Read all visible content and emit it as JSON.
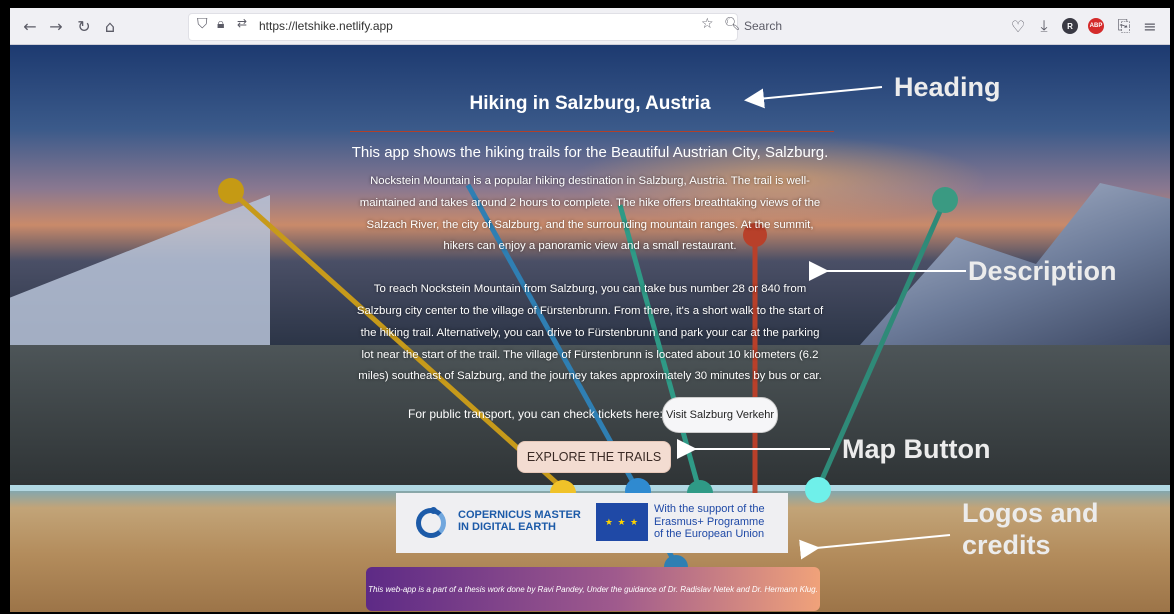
{
  "browser": {
    "url": "https://letshike.netlify.app",
    "search_placeholder": "Search",
    "icons": [
      "back-icon",
      "forward-icon",
      "reload-icon",
      "home-icon",
      "shield-icon",
      "lock-icon",
      "permissions-icon",
      "star-icon",
      "search-icon",
      "pocket-icon",
      "download-icon",
      "account-icon",
      "adblock-icon",
      "extensions-icon",
      "menu-icon"
    ],
    "account_letter": "R",
    "adblock_label": "ABP"
  },
  "page": {
    "heading": "Hiking in Salzburg, Austria",
    "subtitle": "This app shows the hiking trails for the Beautiful Austrian City, Salzburg.",
    "description_1": "Nockstein Mountain is a popular hiking destination in Salzburg, Austria. The trail is well-maintained and takes around 2 hours to complete. The hike offers breathtaking views of the Salzach River, the city of Salzburg, and the surrounding mountain ranges. At the summit, hikers can enjoy a panoramic view and a small restaurant.",
    "description_2": "To reach Nockstein Mountain from Salzburg, you can take bus number 28 or 840 from Salzburg city center to the village of Fürstenbrunn. From there, it's a short walk to the start of the hiking trail. Alternatively, you can drive to Fürstenbrunn and park your car at the parking lot near the start of the trail. The village of Fürstenbrunn is located about 10 kilometers (6.2 miles) southeast of Salzburg, and the journey takes approximately 30 minutes by bus or car.",
    "transport_text": "For public transport, you can check tickets here:",
    "visit_button": "Visit Salzburg Verkehr",
    "explore_button": "EXPLORE THE TRAILS",
    "logos": {
      "copernicus": "COPERNICUS MASTER\nIN DIGITAL EARTH",
      "eu": "With the support of the\nErasmus+ Programme\nof the European Union",
      "eu_flag": "★ ★ ★"
    },
    "credit": "This web-app is a part of a thesis work done by Ravi Pandey, Under the guidance of Dr. Radislav Netek and Dr. Hermann Klug."
  },
  "annotations": {
    "heading": "Heading",
    "description": "Description",
    "map_button": "Map Button",
    "logos": "Logos and\ncredits"
  },
  "colors": {
    "trail_yellow": "#d8a21c",
    "trail_teal": "#2f9a86",
    "trail_blue": "#2f7fb3",
    "trail_red": "#b8402a",
    "trail_cyan": "#6ff0ea",
    "explore_bg": "#f3dcd1"
  }
}
